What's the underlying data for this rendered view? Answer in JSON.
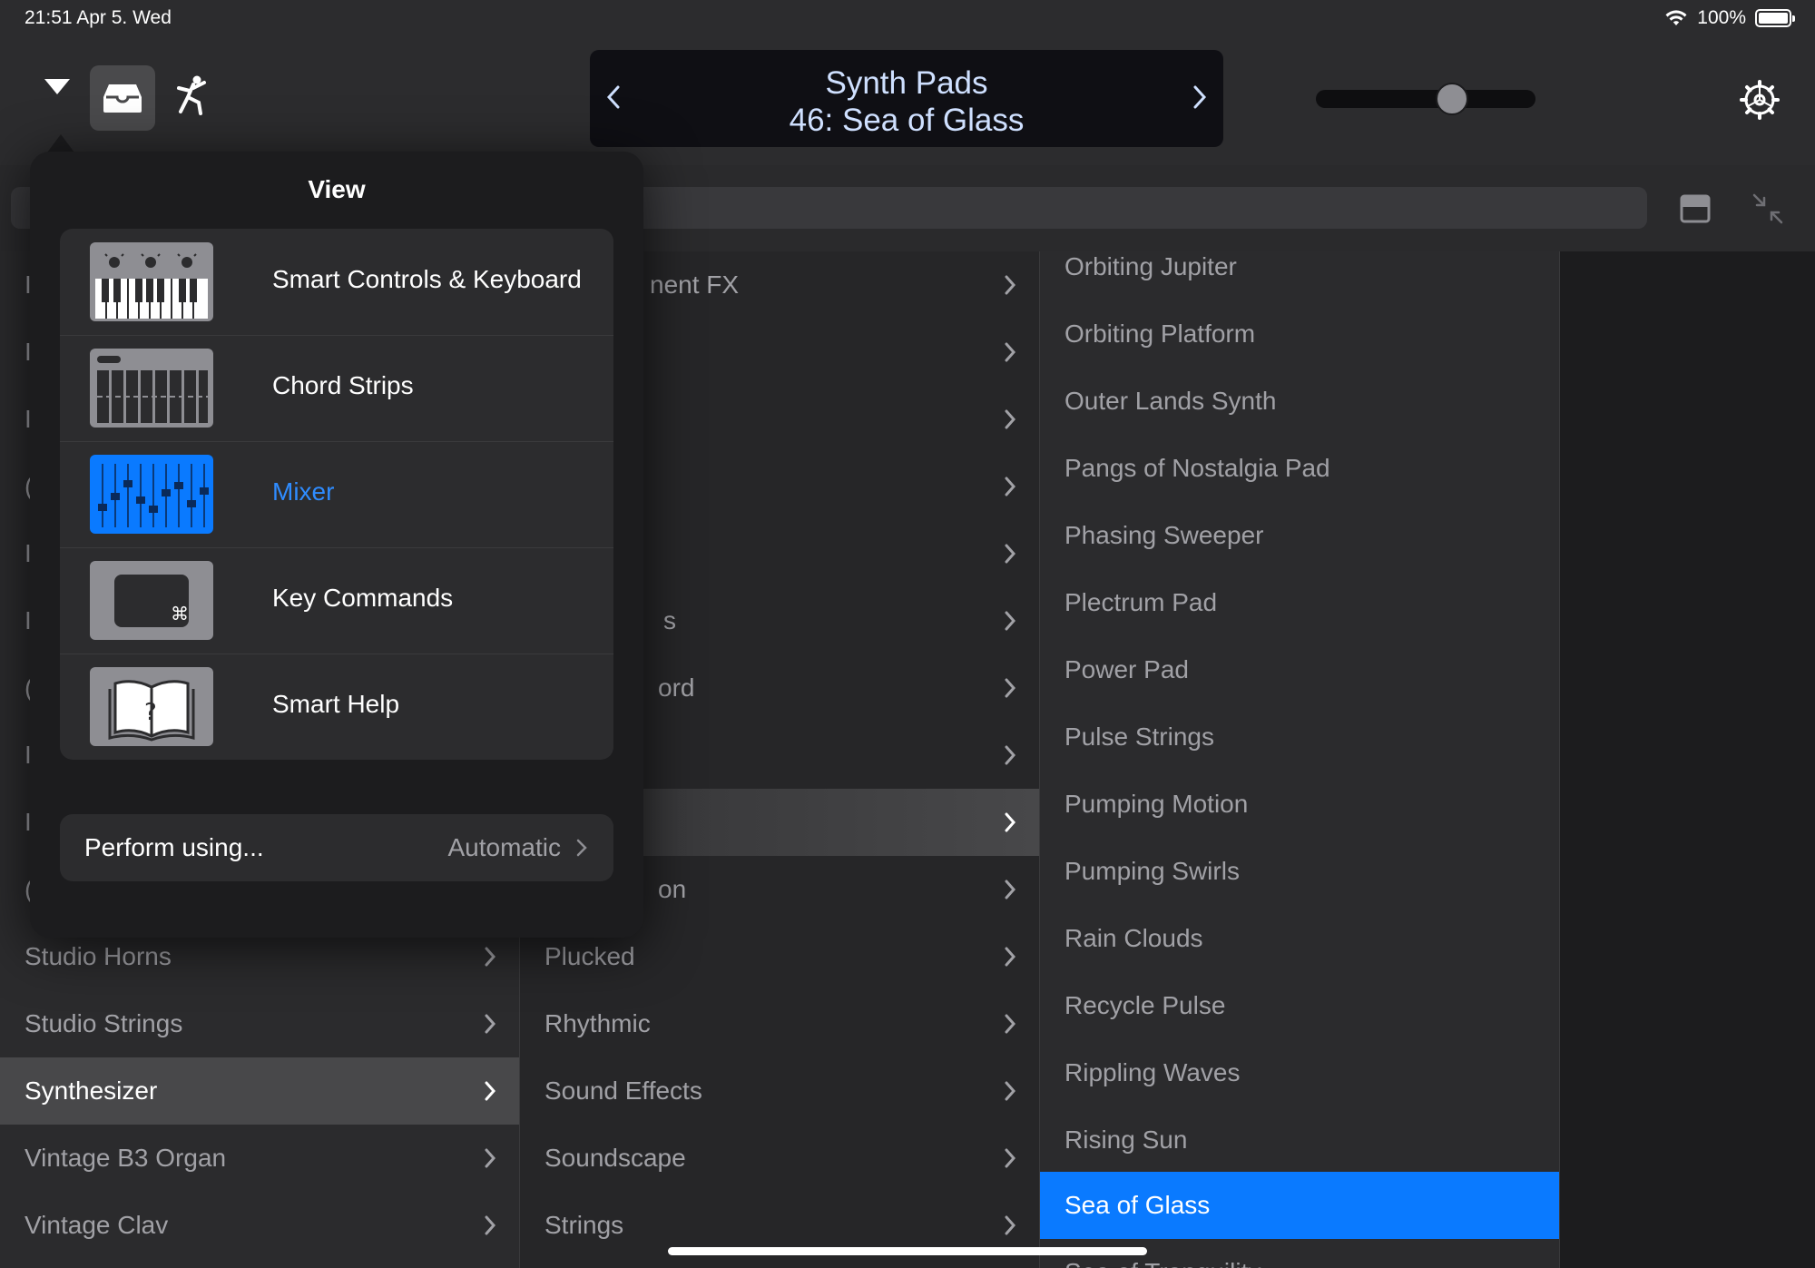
{
  "status": {
    "time_date": "21:51  Apr 5. Wed",
    "battery": "100%"
  },
  "patch": {
    "category": "Synth Pads",
    "name": "46: Sea of Glass"
  },
  "volume": {
    "level": 0.62
  },
  "col1": {
    "items": [
      {
        "label": "I"
      },
      {
        "label": "I"
      },
      {
        "label": "I"
      },
      {
        "label": "("
      },
      {
        "label": "I"
      },
      {
        "label": "I"
      },
      {
        "label": "("
      },
      {
        "label": "I"
      },
      {
        "label": "I"
      },
      {
        "label": "("
      },
      {
        "label": "Studio Horns"
      },
      {
        "label": "Studio Strings"
      },
      {
        "label": "Synthesizer"
      },
      {
        "label": "Vintage B3 Organ"
      },
      {
        "label": "Vintage Clav"
      }
    ]
  },
  "col2": {
    "items": [
      {
        "label": "nent FX"
      },
      {
        "label": ""
      },
      {
        "label": ""
      },
      {
        "label": ""
      },
      {
        "label": ""
      },
      {
        "label": "s"
      },
      {
        "label": "ord"
      },
      {
        "label": ""
      },
      {
        "label": ""
      },
      {
        "label": "on"
      },
      {
        "label": "Plucked"
      },
      {
        "label": "Rhythmic"
      },
      {
        "label": "Sound Effects"
      },
      {
        "label": "Soundscape"
      },
      {
        "label": "Strings"
      }
    ]
  },
  "col3": {
    "items": [
      {
        "label": "Orbiting Jupiter"
      },
      {
        "label": "Orbiting Platform"
      },
      {
        "label": "Outer Lands Synth"
      },
      {
        "label": "Pangs of Nostalgia Pad"
      },
      {
        "label": "Phasing Sweeper"
      },
      {
        "label": "Plectrum Pad"
      },
      {
        "label": "Power Pad"
      },
      {
        "label": "Pulse Strings"
      },
      {
        "label": "Pumping Motion"
      },
      {
        "label": "Pumping Swirls"
      },
      {
        "label": "Rain Clouds"
      },
      {
        "label": "Recycle Pulse"
      },
      {
        "label": "Rippling Waves"
      },
      {
        "label": "Rising Sun"
      },
      {
        "label": "Sea of Glass"
      },
      {
        "label": "Sea of Tranquility"
      }
    ]
  },
  "popover": {
    "title": "View",
    "items": [
      {
        "label": "Smart Controls & Keyboard",
        "icon": "smart-controls-keyboard-icon"
      },
      {
        "label": "Chord Strips",
        "icon": "chord-strips-icon"
      },
      {
        "label": "Mixer",
        "icon": "mixer-icon"
      },
      {
        "label": "Key Commands",
        "icon": "key-commands-icon"
      },
      {
        "label": "Smart Help",
        "icon": "smart-help-icon"
      }
    ],
    "perform_label": "Perform using...",
    "perform_value": "Automatic"
  },
  "colors": {
    "accent": "#0a7aff",
    "background": "#1c1c1e",
    "panel": "#2c2c2e"
  }
}
